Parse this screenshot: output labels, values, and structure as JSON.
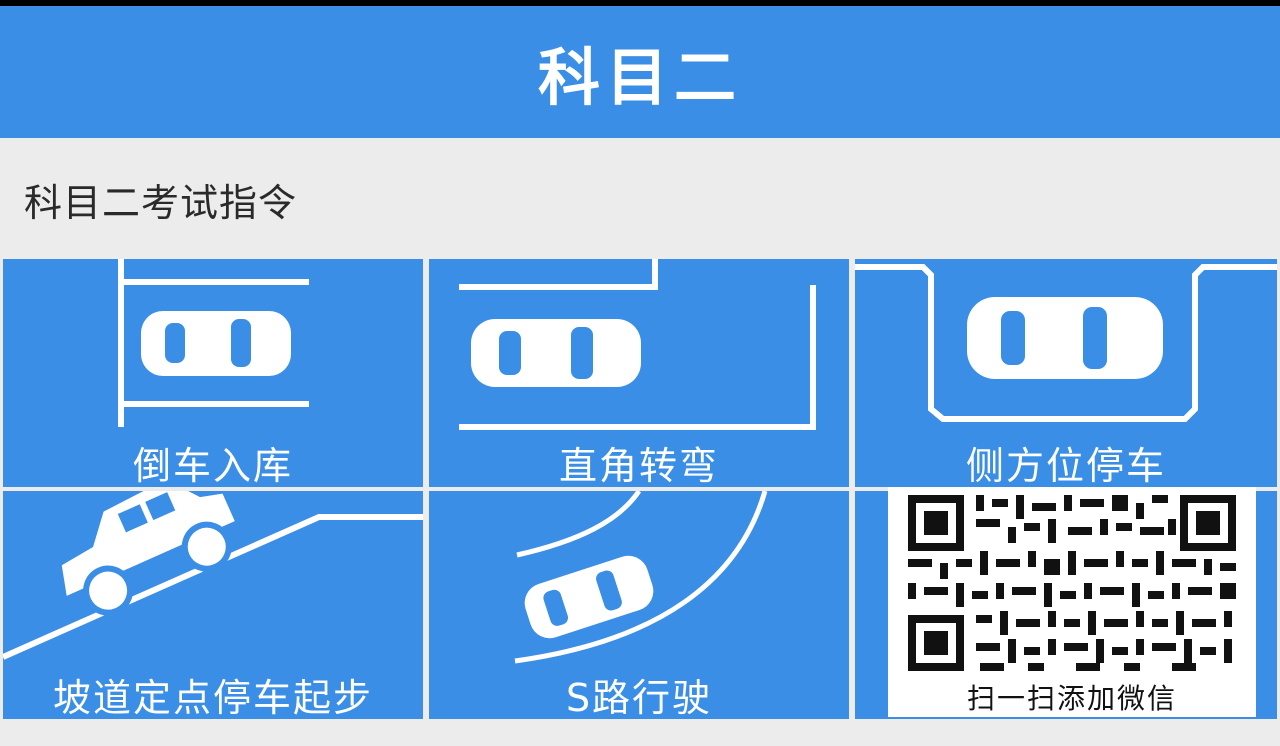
{
  "header": {
    "title": "科目二"
  },
  "section": {
    "title": "科目二考试指令"
  },
  "tiles": [
    {
      "label": "倒车入库"
    },
    {
      "label": "直角转弯"
    },
    {
      "label": "侧方位停车"
    },
    {
      "label": "坡道定点停车起步"
    },
    {
      "label": "S路行驶"
    }
  ],
  "qr": {
    "caption": "扫一扫添加微信"
  },
  "colors": {
    "tile_blue": "#3a8ee6",
    "header_blue": "#3a8ee6",
    "background": "#ececec"
  }
}
